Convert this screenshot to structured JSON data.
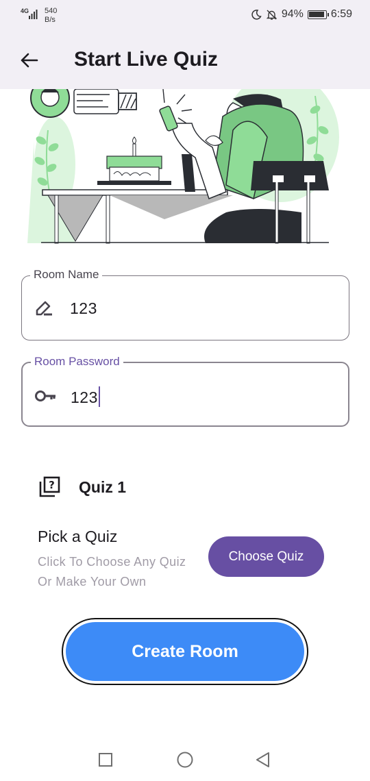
{
  "status_bar": {
    "network_type": "4G",
    "speed_value": "540",
    "speed_unit": "B/s",
    "battery": "94%",
    "time": "6:59",
    "icons": [
      "signal-icon",
      "moon-icon",
      "bell-off-icon",
      "battery-icon"
    ]
  },
  "app_bar": {
    "title": "Start Live Quiz",
    "back_icon": "arrow-left-icon"
  },
  "form": {
    "room_name": {
      "label": "Room Name",
      "value": "123",
      "icon": "edit-pencil-icon"
    },
    "room_password": {
      "label": "Room Password",
      "value": "123",
      "icon": "key-icon",
      "focused": true
    }
  },
  "quiz": {
    "icon": "quiz-question-icon",
    "name": "Quiz 1",
    "pick_title": "Pick a Quiz",
    "pick_subtitle": "Click To Choose Any Quiz Or Make Your Own",
    "choose_button": "Choose Quiz"
  },
  "create_button": "Create Room",
  "nav_bar": {
    "icons": [
      "recents-square-icon",
      "home-circle-icon",
      "back-triangle-icon"
    ]
  },
  "colors": {
    "app_bar_bg": "#f2eff5",
    "primary": "#674fa3",
    "create_button": "#3d8bf7",
    "illustration_green": "#8fdc97",
    "illustration_light_green": "#dcf5de"
  }
}
